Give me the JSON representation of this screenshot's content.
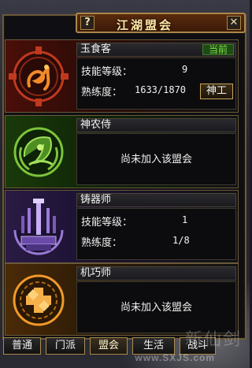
{
  "window": {
    "title": "江湖盟会",
    "help_label": "?",
    "close_label": "✕"
  },
  "guilds": [
    {
      "name": "玉食客",
      "status": "当前",
      "skill_level_label": "技能等级：",
      "skill_level": "9",
      "proficiency_label": "熟练度：",
      "proficiency": "1633/1870",
      "action_label": "神工",
      "emblem_icon": "dragon-emblem-icon",
      "emblem_color": "#c0391f"
    },
    {
      "name": "神农侍",
      "not_joined": "尚未加入该盟会",
      "emblem_icon": "leaf-emblem-icon",
      "emblem_color": "#7cc43a"
    },
    {
      "name": "铸器师",
      "skill_level_label": "技能等级：",
      "skill_level": "1",
      "proficiency_label": "熟练度：",
      "proficiency": "1/8",
      "emblem_icon": "anvil-emblem-icon",
      "emblem_color": "#9a7ad8"
    },
    {
      "name": "机巧师",
      "not_joined": "尚未加入该盟会",
      "emblem_icon": "gear-emblem-icon",
      "emblem_color": "#f09a2a"
    }
  ],
  "tabs": [
    {
      "label": "普通"
    },
    {
      "label": "门派"
    },
    {
      "label": "盟会",
      "active": true
    },
    {
      "label": "生活"
    },
    {
      "label": "战斗"
    }
  ],
  "watermark": {
    "logo": "新仙剑",
    "url": "www.SXJS.com"
  }
}
